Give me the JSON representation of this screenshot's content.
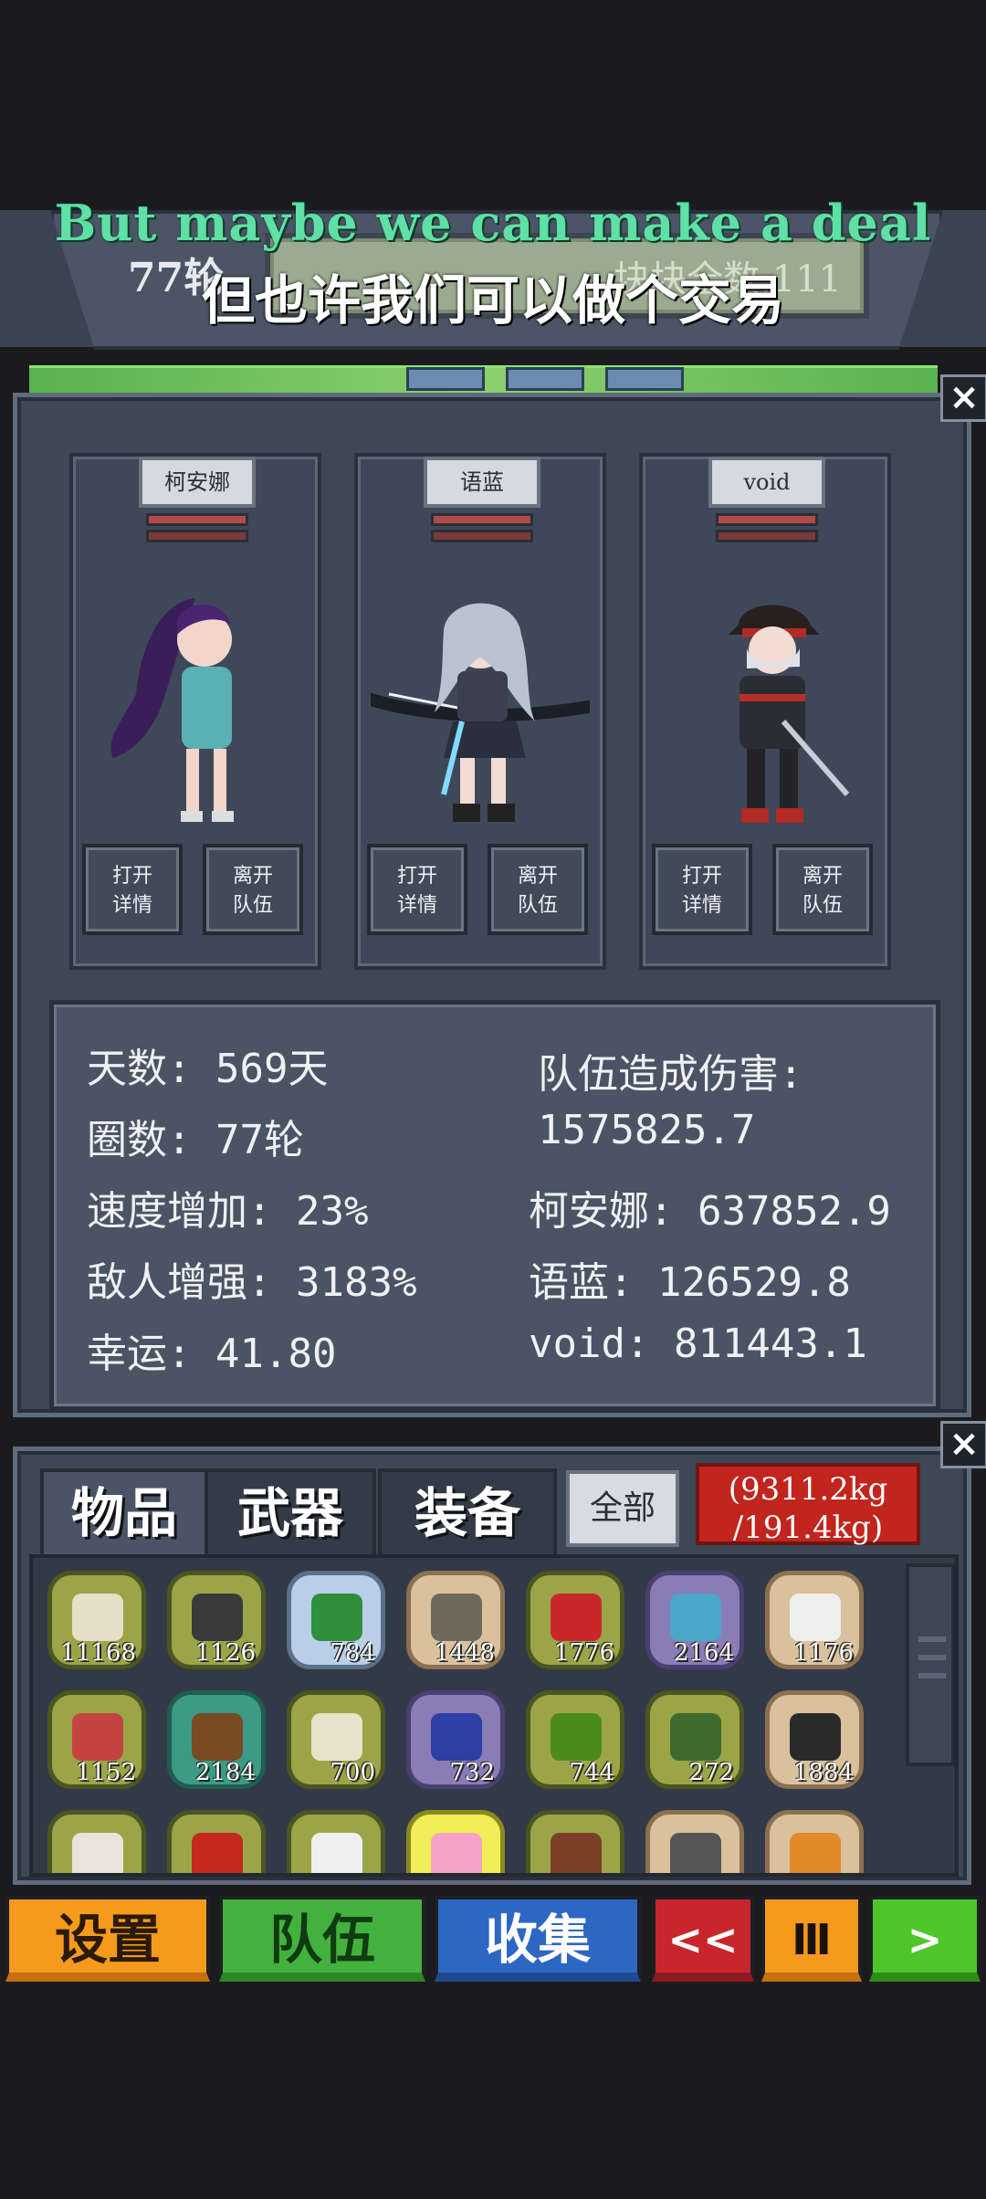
{
  "header": {
    "round_label": "77轮",
    "kill_count": "块块全数:111",
    "subtitle_en": "But maybe we can make a deal",
    "subtitle_zh": "但也许我们可以做个交易"
  },
  "team": {
    "members": [
      {
        "name": "柯安娜",
        "open_label": [
          "打开",
          "详情"
        ],
        "leave_label": [
          "离开",
          "队伍"
        ]
      },
      {
        "name": "语蓝",
        "open_label": [
          "打开",
          "详情"
        ],
        "leave_label": [
          "离开",
          "队伍"
        ]
      },
      {
        "name": "void",
        "open_label": [
          "打开",
          "详情"
        ],
        "leave_label": [
          "离开",
          "队伍"
        ]
      }
    ]
  },
  "stats": {
    "days": "天数: 569天",
    "rounds": "圈数: 77轮",
    "speed": "速度增加: 23%",
    "enemy": "敌人增强: 3183%",
    "luck": "幸运: 41.80",
    "damage_title": "队伍造成伤害:",
    "damage_total": "1575825.7",
    "dmg_1": "柯安娜: 637852.9",
    "dmg_2": "语蓝: 126529.8",
    "dmg_3": "void: 811443.1"
  },
  "inventory": {
    "tabs": [
      "物品",
      "武器",
      "装备"
    ],
    "all_label": "全部",
    "weight_line1": "(9311.2kg",
    "weight_line2": "/191.4kg)",
    "items": [
      {
        "icon": "supplies-icon",
        "count": "11168",
        "style": "olive",
        "color": "#e6e0c8"
      },
      {
        "icon": "boots-icon",
        "count": "1126",
        "style": "olive",
        "color": "#3a3a3a"
      },
      {
        "icon": "circuit-board-icon",
        "count": "784",
        "style": "blue",
        "color": "#2f8f3b"
      },
      {
        "icon": "stone-icon",
        "count": "1448",
        "style": "tan",
        "color": "#6d6a5c"
      },
      {
        "icon": "steak-icon",
        "count": "1776",
        "style": "olive",
        "color": "#c9282b"
      },
      {
        "icon": "shirt-icon",
        "count": "2164",
        "style": "purple",
        "color": "#4aa7c9"
      },
      {
        "icon": "medkit-icon",
        "count": "1176",
        "style": "tan",
        "color": "#eeeeee"
      },
      {
        "icon": "raw-meat-icon",
        "count": "1152",
        "style": "olive",
        "color": "#c64343"
      },
      {
        "icon": "wood-log-icon",
        "count": "2184",
        "style": "teal",
        "color": "#7a4a22"
      },
      {
        "icon": "egg-icon",
        "count": "700",
        "style": "olive",
        "color": "#e9e1c9"
      },
      {
        "icon": "rocket-icon",
        "count": "732",
        "style": "purple",
        "color": "#2d3ea4"
      },
      {
        "icon": "apple-icon",
        "count": "744",
        "style": "olive",
        "color": "#4c8a1e"
      },
      {
        "icon": "herb-icon",
        "count": "272",
        "style": "olive",
        "color": "#3f6a2e"
      },
      {
        "icon": "rope-icon",
        "count": "1884",
        "style": "tan",
        "color": "#2a2a2a"
      },
      {
        "icon": "bottle-icon",
        "count": "",
        "style": "olive",
        "color": "#e9e4d9"
      },
      {
        "icon": "chili-icon",
        "count": "",
        "style": "olive",
        "color": "#c5281e"
      },
      {
        "icon": "flour-icon",
        "count": "",
        "style": "olive",
        "color": "#f0f0f0"
      },
      {
        "icon": "potion-icon",
        "count": "",
        "style": "yellow",
        "color": "#f7a3c9"
      },
      {
        "icon": "chocolate-icon",
        "count": "",
        "style": "olive",
        "color": "#7a3f24"
      },
      {
        "icon": "gun-icon",
        "count": "",
        "style": "tan",
        "color": "#555555"
      },
      {
        "icon": "bread-icon",
        "count": "",
        "style": "tan",
        "color": "#e08a2a"
      }
    ]
  },
  "nav": {
    "settings": "设置",
    "team": "队伍",
    "collect": "收集",
    "rewind": "<<",
    "pause": "Ⅲ",
    "play": ">"
  },
  "icons": {
    "close": "×"
  }
}
